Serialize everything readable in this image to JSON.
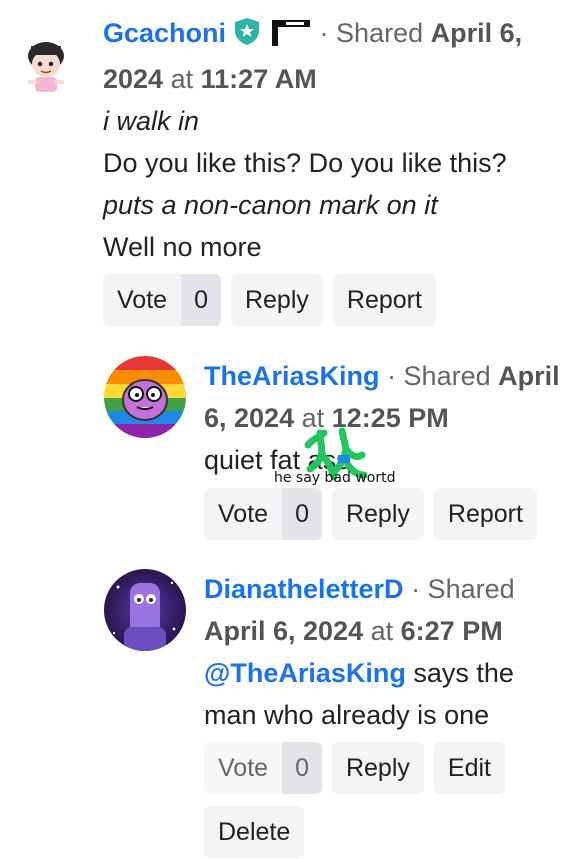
{
  "comments": [
    {
      "username": "Gcachoni",
      "shared_prefix": "· Shared",
      "date": "April 6,",
      "date2": "2024",
      "at": "at",
      "time": "11:27 AM",
      "lines": [
        "i walk in",
        "Do you like this? Do you like this?",
        "puts a non-canon mark on it",
        "Well no more"
      ],
      "vote_label": "Vote",
      "vote_count": "0",
      "reply_label": "Reply",
      "report_label": "Report"
    },
    {
      "username": "TheAriasKing",
      "shared_prefix": "· Shared",
      "date": "April",
      "date2": "6, 2024",
      "at": "at",
      "time": "12:25 PM",
      "text": "quiet fat ass",
      "scribble": "he say bad wortd",
      "vote_label": "Vote",
      "vote_count": "0",
      "reply_label": "Reply",
      "report_label": "Report"
    },
    {
      "username": "DianatheletterD",
      "shared_prefix": "· Shared",
      "date": "April 6, 2024",
      "at": "at",
      "time": "6:27 PM",
      "mention": "@TheAriasKing",
      "text_after_mention": "says the",
      "text_line2": "man who already is one",
      "vote_label": "Vote",
      "vote_count": "0",
      "reply_label": "Reply",
      "edit_label": "Edit",
      "delete_label": "Delete"
    }
  ],
  "colors": {
    "username": "#1a73e8",
    "button_bg": "#f3f4f6",
    "badge": "#2bb3a3",
    "scribble": "#22c55e"
  },
  "icons": [
    "moderator-shield-icon",
    "flag-glyph-icon"
  ]
}
